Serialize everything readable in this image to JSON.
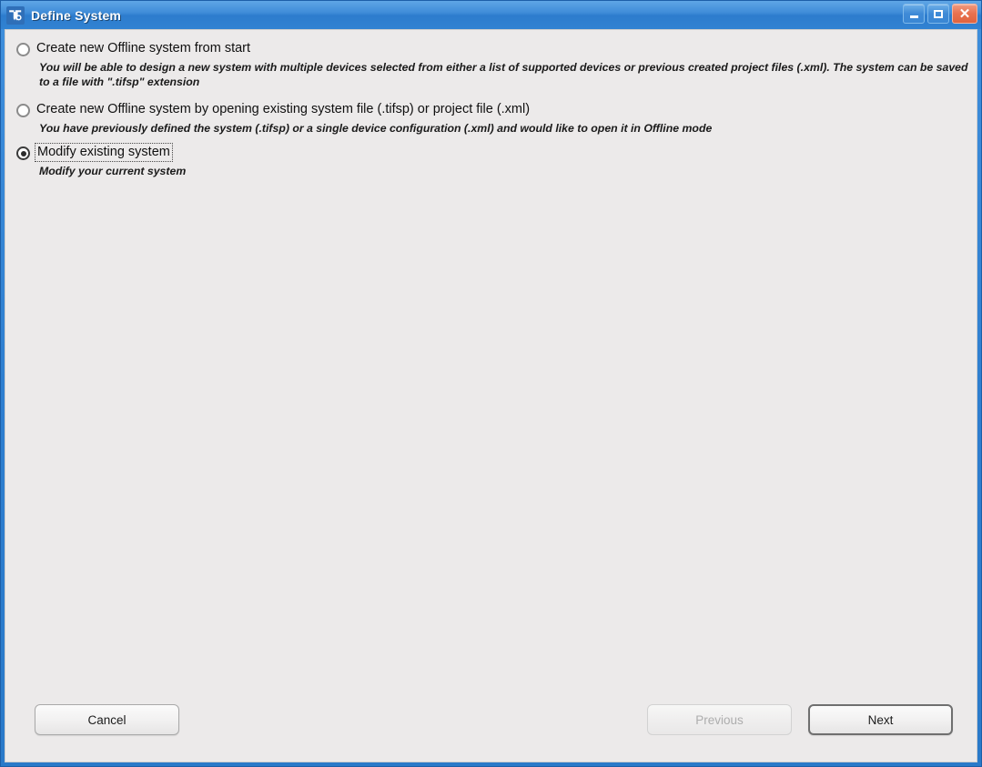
{
  "window": {
    "title": "Define System",
    "icon": "texas-instruments-logo-icon",
    "controls": {
      "minimize_label": "_",
      "maximize_label": "□",
      "close_label": "✕"
    }
  },
  "options": [
    {
      "id": "create-new-offline-from-start",
      "label": "Create new Offline system from start",
      "description": "You will be able to design a new system with multiple devices selected from either a list of supported devices or previous created project files (.xml).  The system can be saved to a file with \".tifsp\" extension",
      "selected": false,
      "focused": false
    },
    {
      "id": "create-new-offline-from-file",
      "label": "Create new Offline system by opening existing system file (.tifsp) or project file (.xml)",
      "description": "You have previously defined the system (.tifsp) or a single device configuration (.xml) and would like to open it in Offline mode",
      "selected": false,
      "focused": false
    },
    {
      "id": "modify-existing-system",
      "label": "Modify existing system",
      "description": "Modify your current system",
      "selected": true,
      "focused": true
    }
  ],
  "footer": {
    "cancel_label": "Cancel",
    "previous_label": "Previous",
    "next_label": "Next",
    "previous_enabled": false,
    "next_enabled": true
  },
  "colors": {
    "titlebar_blue": "#3f8cd8",
    "frame_blue": "#2f7fd0",
    "client_background": "#eceaea",
    "close_button_red": "#e8714f"
  }
}
